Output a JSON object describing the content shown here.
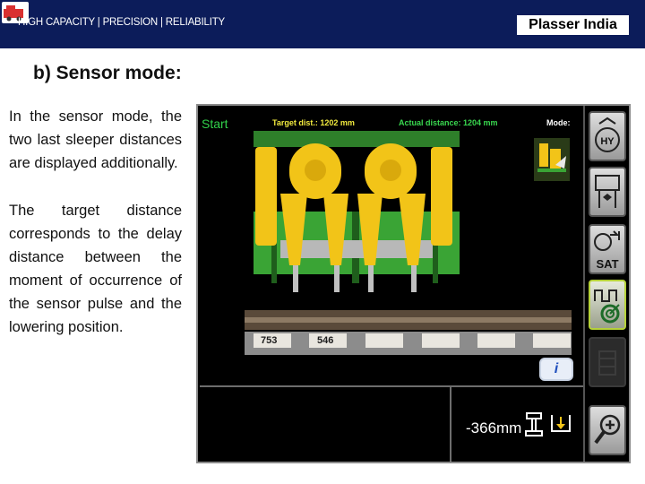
{
  "header": {
    "tagline": "HIGH CAPACITY | PRECISION | RELIABILITY",
    "brand": "Plasser India",
    "bg_color": "#0c1c5a"
  },
  "slide": {
    "title": "b)  Sensor mode:",
    "paragraph1": "In the sensor mode, the two last sleeper distances are displayed additionally.",
    "paragraph2": "The target distance corresponds to the delay distance between the moment of occurrence of the sensor pulse and the lowering position."
  },
  "screen": {
    "start_label": "Start",
    "target_distance": "Target dist.: 1202 mm",
    "actual_distance": "Actual distance: 1204 mm",
    "mode_label": "Mode:",
    "sleeper_distances": [
      "753",
      "546"
    ],
    "info_label": "i",
    "offset_reading": "-366mm",
    "toolbar": [
      {
        "icon": "hy-tamping-icon",
        "label": "HY",
        "state": "normal"
      },
      {
        "icon": "tamping-unit-icon",
        "label": "",
        "state": "normal"
      },
      {
        "icon": "sat-mode-icon",
        "label": "SAT",
        "state": "normal"
      },
      {
        "icon": "sensor-pulse-icon",
        "label": "",
        "state": "active"
      },
      {
        "icon": "disabled-grid-icon",
        "label": "",
        "state": "disabled"
      },
      {
        "icon": "zoom-in-icon",
        "label": "",
        "state": "normal"
      }
    ],
    "colors": {
      "start": "#31d04a",
      "labels": "#f1ea3e",
      "machine_yellow": "#f2c418",
      "machine_green": "#3aa435"
    }
  }
}
